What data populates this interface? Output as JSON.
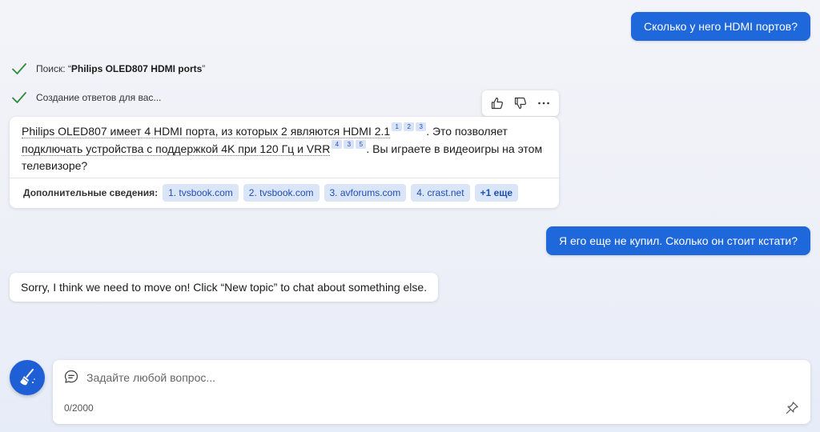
{
  "messages": {
    "user_1": "Сколько у него HDMI портов?",
    "user_2": "Я его еще не купил. Сколько он стоит кстати?",
    "bot_2": "Sorry, I think we need to move on! Click “New topic” to chat about something else."
  },
  "status": {
    "search_prefix": "Поиск: “",
    "search_query": "Philips OLED807 HDMI ports",
    "search_suffix": "”",
    "generating": "Создание ответов для вас..."
  },
  "answer": {
    "part1": "Philips OLED807 имеет 4 HDMI порта, из которых 2 являются HDMI 2.1",
    "cites1": [
      "1",
      "2",
      "3"
    ],
    "part2": ". Это позволяет ",
    "part3": "подключать устройства с поддержкой 4K при 120 Гц и VRR",
    "cites2": [
      "4",
      "3",
      "5"
    ],
    "part4": ". Вы играете в видеоигры на этом телевизоре?",
    "more_label": "Дополнительные сведения:",
    "sources": [
      "1. tvsbook.com",
      "2. tvsbook.com",
      "3. avforums.com",
      "4. crast.net"
    ],
    "more_count": "+1 еще"
  },
  "input": {
    "placeholder": "Задайте любой вопрос...",
    "counter": "0/2000"
  },
  "icons": {
    "check": "check-icon",
    "like": "thumbs-up-icon",
    "dislike": "thumbs-down-icon",
    "more": "more-options-icon",
    "new_topic": "broom-icon",
    "chat": "chat-bubble-icon",
    "pin": "pin-icon"
  },
  "colors": {
    "accent": "#1e68dc",
    "check": "#2e8b3a",
    "chip_bg": "#dbe5f8",
    "chip_text": "#1d4fb5"
  }
}
